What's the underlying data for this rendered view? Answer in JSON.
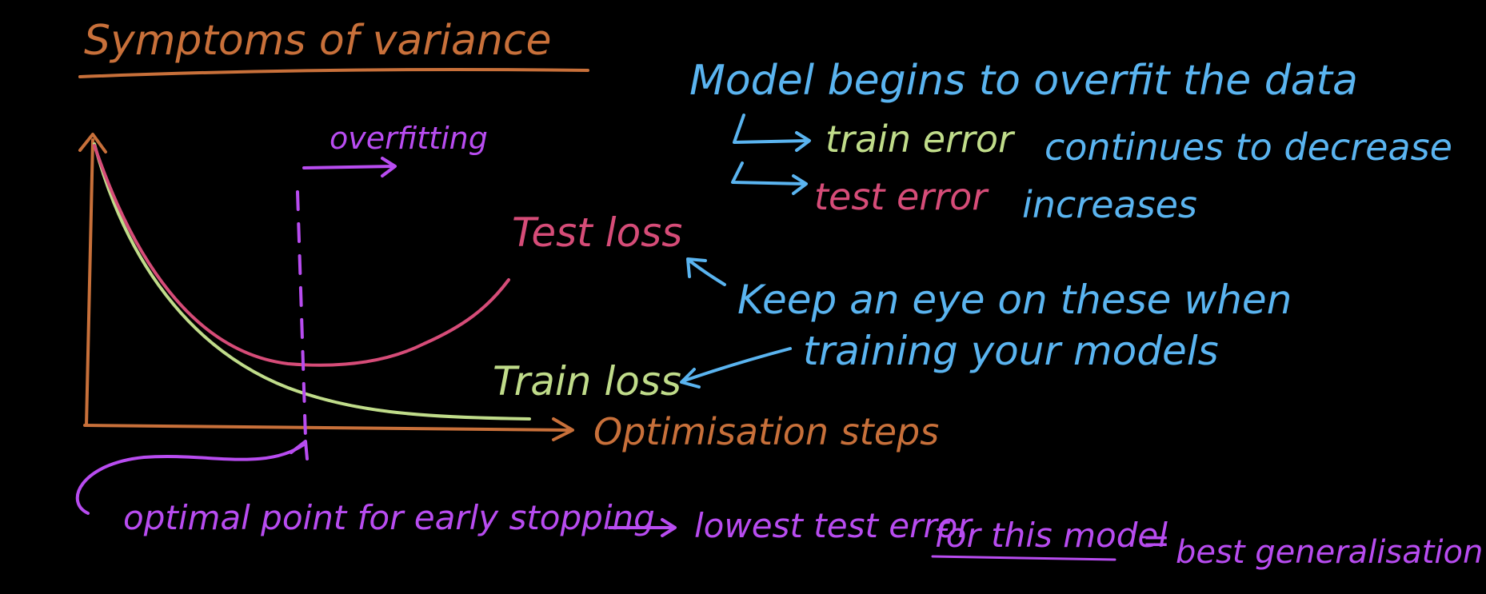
{
  "colors": {
    "background": "#000000",
    "orange": "#c8703a",
    "blue": "#5ab4f0",
    "green": "#c0dc8a",
    "pink": "#d64c78",
    "purple": "#b84cf0"
  },
  "title": "Symptoms of variance",
  "notes": {
    "overfit_heading": "Model begins to overfit the data",
    "train_prefix": "train error",
    "train_suffix": "continues to decrease",
    "test_prefix": "test error",
    "test_suffix": "increases",
    "keep_eye_line1": "Keep an eye on these when",
    "keep_eye_line2": "training your models"
  },
  "chart": {
    "overfitting_label": "overfitting",
    "test_loss_label": "Test loss",
    "train_loss_label": "Train loss",
    "x_axis_label": "Optimisation steps"
  },
  "bottom": {
    "optimal_point": "optimal point for early stopping",
    "lowest_error": "lowest test error",
    "for_this_model": "for this model",
    "equals": "=",
    "best_generalisation": "best generalisation"
  }
}
